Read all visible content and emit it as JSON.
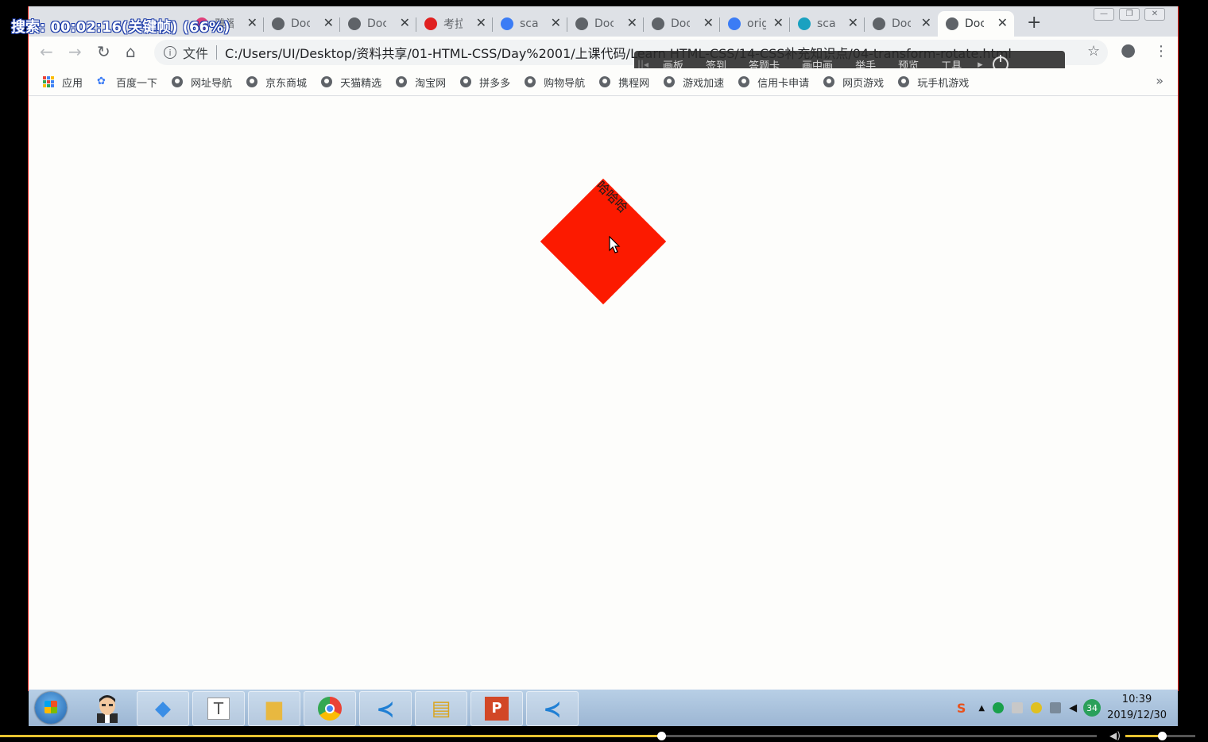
{
  "recording_overlay": "搜索: 00:02:16(关键帧) (66%)",
  "tabs": [
    {
      "title": "雅阁",
      "icon": "pink-square-icon",
      "color": "#e0407a"
    },
    {
      "title": "Doc",
      "icon": "globe-icon",
      "color": "#5f6368"
    },
    {
      "title": "Doc",
      "icon": "globe-icon",
      "color": "#5f6368"
    },
    {
      "title": "考拉",
      "icon": "kaola-icon",
      "color": "#e02020"
    },
    {
      "title": "scal",
      "icon": "baidu-paw-icon",
      "color": "#3b7cf5"
    },
    {
      "title": "Doc",
      "icon": "globe-icon",
      "color": "#5f6368"
    },
    {
      "title": "Doc",
      "icon": "globe-icon",
      "color": "#5f6368"
    },
    {
      "title": "orig",
      "icon": "baidu-paw-icon",
      "color": "#3b7cf5"
    },
    {
      "title": "sca",
      "icon": "mdn-icon",
      "color": "#1aa1c0"
    },
    {
      "title": "Doc",
      "icon": "globe-icon",
      "color": "#5f6368"
    },
    {
      "title": "Doc",
      "icon": "globe-icon",
      "color": "#5f6368",
      "active": true
    }
  ],
  "omnibox": {
    "label": "文件",
    "url": "C:/Users/UI/Desktop/资料共享/01-HTML-CSS/Day%2001/上课代码/Learn HTML-CSS/14-CSS补充知识点/04-transform-rotate.html"
  },
  "classbar": {
    "items": [
      "画板",
      "签到",
      "答题卡",
      "画中画",
      "举手",
      "预览",
      "工具"
    ]
  },
  "bookmarks": {
    "apps_label": "应用",
    "items": [
      "百度一下",
      "网址导航",
      "京东商城",
      "天猫精选",
      "淘宝网",
      "拼多多",
      "购物导航",
      "携程网",
      "游戏加速",
      "信用卡申请",
      "网页游戏",
      "玩手机游戏"
    ],
    "more": "»"
  },
  "page": {
    "box_text": "哈哈哈",
    "box_color": "#fc1a00",
    "rotation_deg": 45
  },
  "taskbar": {
    "apps": [
      "avatar",
      "feishu-icon",
      "typora-icon",
      "file-explorer-icon",
      "chrome-icon",
      "vscode-icon",
      "notepad-icon",
      "powerpoint-icon",
      "vscode-icon"
    ],
    "tray_badge": "34",
    "time": "10:39",
    "date": "2019/12/30"
  },
  "player": {
    "progress": 0.603,
    "volume": 0.52
  }
}
